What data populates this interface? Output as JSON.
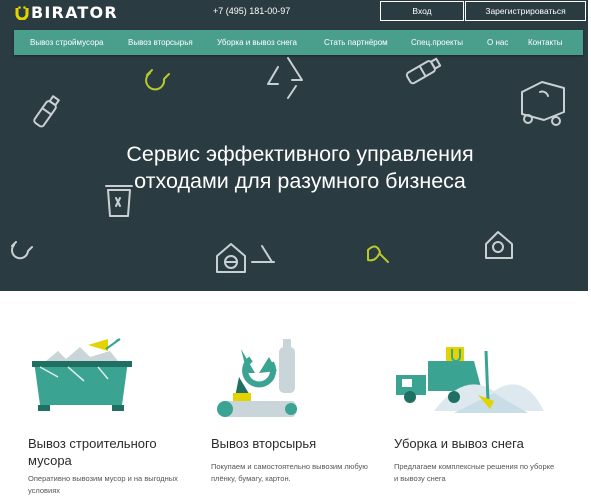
{
  "brand": {
    "logo_text": "BIRATOR"
  },
  "header": {
    "phone": "+7 (495) 181-00-97",
    "login_label": "Вход",
    "register_label": "Зарегистрироваться"
  },
  "nav": {
    "items": [
      {
        "label": "Вывоз строймусора"
      },
      {
        "label": "Вывоз вторсырья"
      },
      {
        "label": "Уборка и вывоз снега"
      },
      {
        "label": "Стать партнёром"
      },
      {
        "label": "Спец.проекты"
      },
      {
        "label": "О нас"
      },
      {
        "label": "Контакты"
      }
    ]
  },
  "hero": {
    "title_line1": "Сервис эффективного управления",
    "title_line2": "отходами для разумного бизнеса"
  },
  "services": [
    {
      "title_line1": "Вывоз строительного",
      "title_line2": "мусора",
      "desc_line1": "Оперативно вывозим мусор и на выгодных",
      "desc_line2": "условиях"
    },
    {
      "title_line1": "Вывоз вторсырья",
      "desc_line1": "Покупаем и самостоятельно вывозим любую",
      "desc_line2": "плёнку, бумагу, картон."
    },
    {
      "title_line1": "Уборка и вывоз снега",
      "desc_line1": "Предлагаем комплексные решения по уборке",
      "desc_line2": "и вывозу снега"
    }
  ],
  "colors": {
    "hero_bg": "#2b3b42",
    "nav_bg": "#4a9e8c",
    "accent_yellow": "#e3d400",
    "accent_teal": "#3aa392"
  }
}
